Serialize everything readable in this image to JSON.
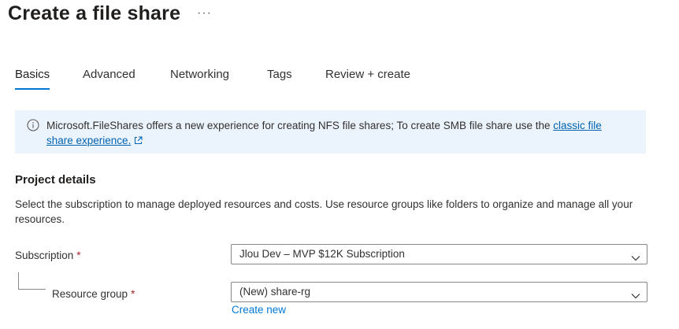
{
  "header": {
    "title": "Create a file share",
    "more_label": "···"
  },
  "tabs": [
    {
      "label": "Basics",
      "active": true
    },
    {
      "label": "Advanced",
      "active": false
    },
    {
      "label": "Networking",
      "active": false
    },
    {
      "label": "Tags",
      "active": false
    },
    {
      "label": "Review + create",
      "active": false
    }
  ],
  "banner": {
    "icon": "info-icon",
    "text": "Microsoft.FileShares offers a new experience for creating NFS file shares; To create SMB file share use the ",
    "link_text": "classic file share experience.",
    "link_icon": "external-link-icon"
  },
  "project_details": {
    "title": "Project details",
    "description": "Select the subscription to manage deployed resources and costs. Use resource groups like folders to organize and manage all your resources."
  },
  "fields": {
    "subscription": {
      "label": "Subscription",
      "required_mark": "*",
      "value": "Jlou Dev – MVP $12K Subscription"
    },
    "resource_group": {
      "label": "Resource group",
      "required_mark": "*",
      "value": "(New) share-rg",
      "create_new": "Create new"
    }
  },
  "colors": {
    "accent": "#0078d4",
    "banner_bg": "#ebf3fc",
    "required": "#a4262c"
  }
}
